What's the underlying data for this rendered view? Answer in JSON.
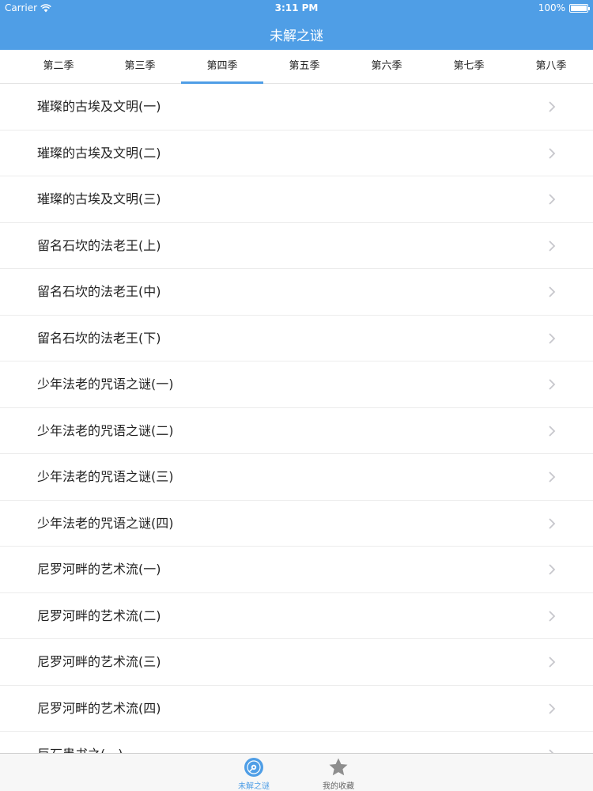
{
  "status_bar": {
    "carrier": "Carrier",
    "time": "3:11 PM",
    "battery": "100%"
  },
  "nav": {
    "title": "未解之谜"
  },
  "tabs": [
    {
      "label": "第二季"
    },
    {
      "label": "第三季"
    },
    {
      "label": "第四季",
      "active": true
    },
    {
      "label": "第五季"
    },
    {
      "label": "第六季"
    },
    {
      "label": "第七季"
    },
    {
      "label": "第八季"
    }
  ],
  "list": [
    {
      "title": "璀璨的古埃及文明(一)"
    },
    {
      "title": "璀璨的古埃及文明(二)"
    },
    {
      "title": "璀璨的古埃及文明(三)"
    },
    {
      "title": "留名石坎的法老王(上)"
    },
    {
      "title": "留名石坎的法老王(中)"
    },
    {
      "title": "留名石坎的法老王(下)"
    },
    {
      "title": "少年法老的咒语之谜(一)"
    },
    {
      "title": "少年法老的咒语之谜(二)"
    },
    {
      "title": "少年法老的咒语之谜(三)"
    },
    {
      "title": "少年法老的咒语之谜(四)"
    },
    {
      "title": "尼罗河畔的艺术流(一)"
    },
    {
      "title": "尼罗河畔的艺术流(二)"
    },
    {
      "title": "尼罗河畔的艺术流(三)"
    },
    {
      "title": "尼罗河畔的艺术流(四)"
    },
    {
      "title": "巨石患书之(一)"
    }
  ],
  "tabbar": [
    {
      "label": "未解之谜",
      "icon": "disc-icon",
      "active": true
    },
    {
      "label": "我的收藏",
      "icon": "star-icon"
    }
  ],
  "colors": {
    "accent": "#4f9ee6",
    "inactive_icon": "#8e8e8e",
    "chevron": "#c7c7cc"
  }
}
